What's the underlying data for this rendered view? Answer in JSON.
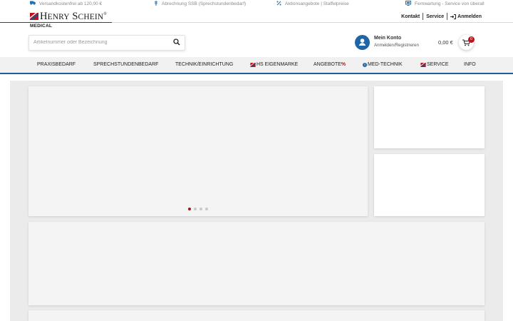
{
  "topbar": {
    "items": [
      {
        "label": "Versandkostenfrei ab 120,00 €",
        "icon": "truck-icon"
      },
      {
        "label": "Abrechnung SSB (Sprechstundenbedarf)",
        "icon": "medical-icon"
      },
      {
        "label": "Aktionsangebote | Staffelpreise",
        "icon": "percent-icon"
      },
      {
        "label": "Fernwartung - Service von überall",
        "icon": "monitor-icon"
      }
    ]
  },
  "logo": {
    "name": "Henry Schein",
    "sub": "MEDICAL"
  },
  "header_links": {
    "kontakt": "Kontakt",
    "service": "Service",
    "anmelden": "Anmelden"
  },
  "search": {
    "placeholder": "Artikelnummer oder Bezeichnung",
    "value": ""
  },
  "account": {
    "title": "Mein Konto",
    "subtitle": "Anmelden/Registrieren"
  },
  "cart": {
    "total": "0,00 €",
    "count": "0"
  },
  "nav": {
    "items": [
      {
        "label": "PRAXISBEDARF"
      },
      {
        "label": "SPRECHSTUNDENBEDARF"
      },
      {
        "label": "TECHNIK/EINRICHTUNG"
      },
      {
        "label": "HS EIGENMARKE"
      },
      {
        "label": "ANGEBOTE",
        "suffix": "%"
      },
      {
        "label": "MED-TECHNIK"
      },
      {
        "label": "SERVICE"
      },
      {
        "label": "INFO"
      }
    ]
  },
  "carousel": {
    "slide_count": 4,
    "active_slide": 1
  },
  "colors": {
    "brand_red": "#a0161c",
    "brand_blue": "#1d67a8",
    "nav_background": "#f1f1f1"
  }
}
